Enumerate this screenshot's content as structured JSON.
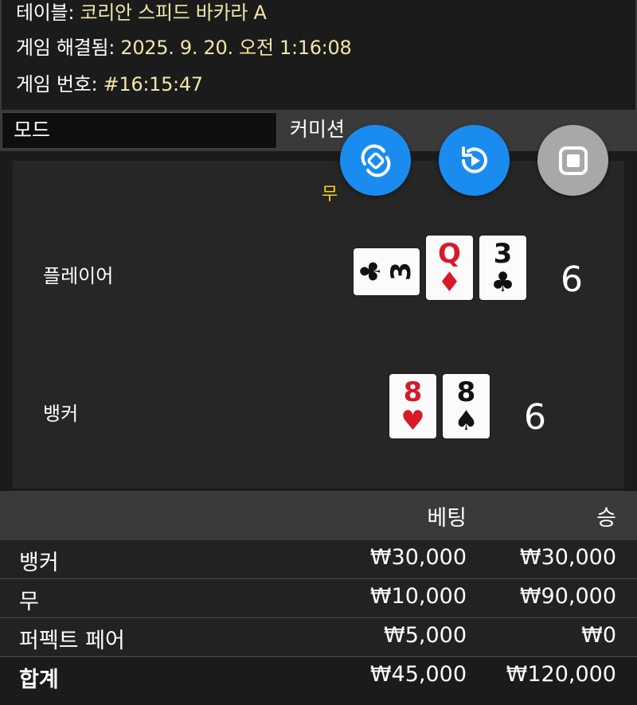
{
  "info": {
    "table_label": "테이블: ",
    "table_value": "코리안 스피드 바카라 A",
    "resolved_label": "게임 해결됨: ",
    "resolved_value": "2025. 9. 20. 오전 1:16:08",
    "number_label": "게임 번호: ",
    "number_value": "#16:15:47"
  },
  "mode": {
    "left_label": "모드",
    "right_label": "커미션"
  },
  "fabs": [
    {
      "icon": "rotate-sync-icon",
      "color": "#1a8cf0"
    },
    {
      "icon": "replay-icon",
      "color": "#1a8cf0"
    },
    {
      "icon": "stop-icon",
      "color": "#a8a8a8"
    }
  ],
  "result": {
    "outcome_label": "무",
    "player_label": "플레이어",
    "player_score": "6",
    "banker_label": "뱅커",
    "banker_score": "6",
    "player_cards": [
      {
        "rank": "3",
        "suit": "♣",
        "color": "black",
        "orientation": "horizontal"
      },
      {
        "rank": "Q",
        "suit": "♦",
        "color": "red",
        "orientation": "vertical"
      },
      {
        "rank": "3",
        "suit": "♣",
        "color": "black",
        "orientation": "vertical"
      }
    ],
    "banker_cards": [
      {
        "rank": "8",
        "suit": "♥",
        "color": "red",
        "orientation": "vertical"
      },
      {
        "rank": "8",
        "suit": "♠",
        "color": "black",
        "orientation": "vertical"
      }
    ]
  },
  "bets": {
    "header_bet": "베팅",
    "header_win": "승",
    "rows": [
      {
        "name": "뱅커",
        "bet": "₩30,000",
        "win": "₩30,000"
      },
      {
        "name": "무",
        "bet": "₩10,000",
        "win": "₩90,000"
      },
      {
        "name": "퍼펙트 페어",
        "bet": "₩5,000",
        "win": "₩0"
      }
    ],
    "total": {
      "name": "합계",
      "bet": "₩45,000",
      "win": "₩120,000"
    }
  }
}
